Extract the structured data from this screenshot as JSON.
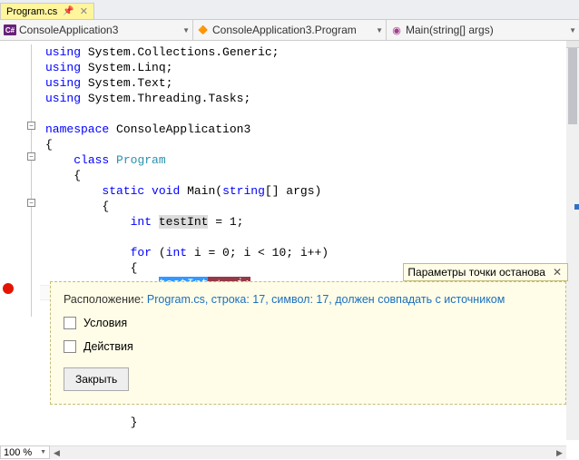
{
  "tab": {
    "label": "Program.cs",
    "pinned": true
  },
  "nav": {
    "project": "ConsoleApplication3",
    "class": "ConsoleApplication3.Program",
    "method": "Main(string[] args)"
  },
  "code": {
    "l1a": "using",
    "l1b": " System.Collections.Generic;",
    "l2a": "using",
    "l2b": " System.Linq;",
    "l3a": "using",
    "l3b": " System.Text;",
    "l4a": "using",
    "l4b": " System.Threading.Tasks;",
    "l6a": "namespace",
    "l6b": " ConsoleApplication3",
    "l7": "{",
    "l8a": "    ",
    "l8b": "class",
    "l8c": " ",
    "l8d": "Program",
    "l9": "    {",
    "l10a": "        ",
    "l10b": "static",
    "l10c": " ",
    "l10d": "void",
    "l10e": " Main(",
    "l10f": "string",
    "l10g": "[] args)",
    "l11": "        {",
    "l12a": "            ",
    "l12b": "int",
    "l12c": " ",
    "l12d": "testInt",
    "l12e": " = 1;",
    "l14a": "            ",
    "l14b": "for",
    "l14c": " (",
    "l14d": "int",
    "l14e": " i = 0; i < 10; i++)",
    "l15": "            {",
    "l16a": "                ",
    "l16b": "testInt",
    "l16c": " += i;",
    "l25": "            }"
  },
  "breakpoint_tooltip": {
    "title": "Параметры точки останова"
  },
  "breakpoint_panel": {
    "loc_label": "Расположение: ",
    "loc_link": "Program.cs, строка: 17, символ: 17, должен совпадать с источником",
    "conditions": "Условия",
    "actions": "Действия",
    "close": "Закрыть"
  },
  "zoom": "100 %"
}
